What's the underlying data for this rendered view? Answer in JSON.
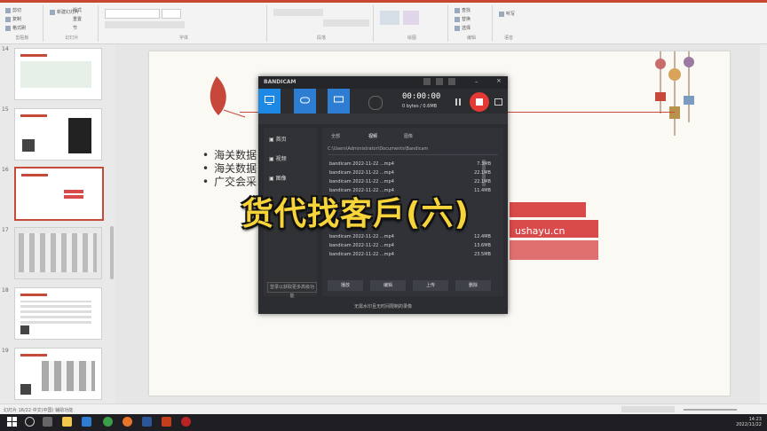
{
  "ribbon": {
    "group_labels": [
      "剪贴板",
      "幻灯片",
      "字体",
      "段落",
      "绘图",
      "编辑",
      "语音"
    ],
    "buttons": [
      "剪切",
      "复制",
      "格式刷",
      "新建幻灯片",
      "版式",
      "重置",
      "节",
      "查找",
      "替换",
      "选择",
      "听写"
    ]
  },
  "thumbnails": {
    "numbers": [
      "14",
      "15",
      "16",
      "17",
      "18",
      "19"
    ],
    "selected_index": 2
  },
  "slide": {
    "bullets": [
      "海关数据",
      "海关数据",
      "广交会采"
    ],
    "url_text": "ushayu.cn"
  },
  "recorder": {
    "title": "BANDICAM",
    "timer": "00:00:00",
    "storage": "0 bytes / 0.6MB",
    "path_label": "C:\\Users\\Administrator\\Documents\\Bandicam",
    "nav_items": [
      "首页",
      "视频",
      "图像"
    ],
    "tabs": [
      "全部",
      "视频",
      "图像"
    ],
    "files": [
      {
        "name": "bandicam 2022-11-22 ...mp4",
        "size": "7.3MB"
      },
      {
        "name": "bandicam 2022-11-22 ...mp4",
        "size": "22.1MB"
      },
      {
        "name": "bandicam 2022-11-22 ...mp4",
        "size": "22.1MB"
      },
      {
        "name": "bandicam 2022-11-22 ...mp4",
        "size": "11.4MB"
      },
      {
        "name": "bandicam 2022-11-22 ...mp4",
        "size": "12.4MB"
      },
      {
        "name": "bandicam 2022-11-22 ...mp4",
        "size": "13.6MB"
      },
      {
        "name": "bandicam 2022-11-22 ...mp4",
        "size": "23.5MB"
      }
    ],
    "action_buttons": [
      "播放",
      "编辑",
      "上传",
      "删除"
    ],
    "upgrade_link": "登录以获取更多高级功能",
    "bottom_note": "无需水印且无时间限制的录像"
  },
  "overlay_text": "货代找客戶(六)",
  "status_bar": "幻灯片 16/22 中文(中国) 辅助功能",
  "taskbar": {
    "time": "14:23",
    "date": "2022/11/22"
  },
  "colors": {
    "accent": "#c8472f",
    "recorder_blue": "#1e88e5",
    "record_red": "#e53935",
    "overlay_yellow": "#f7d43a"
  }
}
